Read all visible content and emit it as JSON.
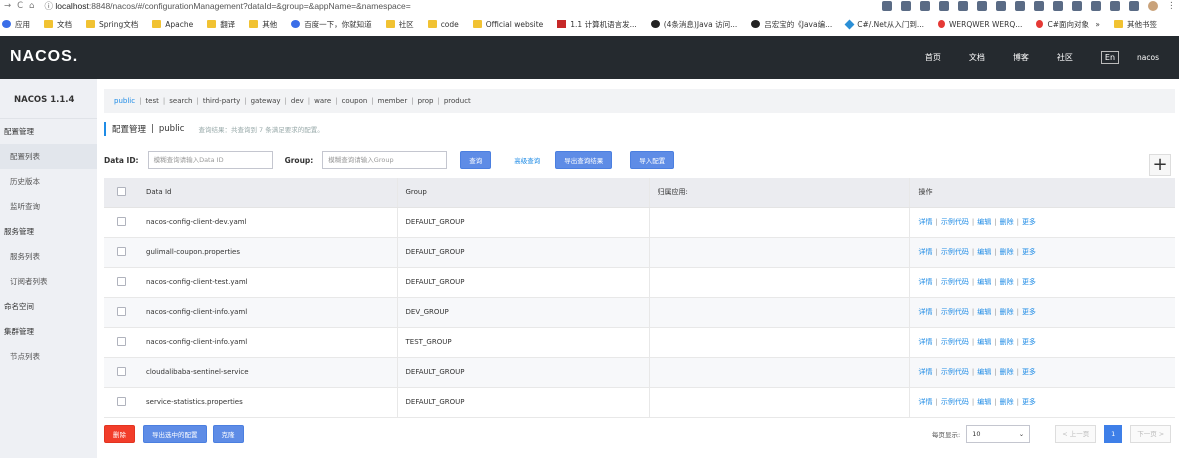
{
  "browser": {
    "url_prefix": "localhost",
    "url_rest": ":8848/nacos/#/configurationManagement?dataId=&group=&appName=&namespace=",
    "bookmarks": [
      {
        "label": "应用",
        "icon": "apps-icon"
      },
      {
        "label": "文档",
        "icon": "folder-icon"
      },
      {
        "label": "Spring文档",
        "icon": "folder-icon"
      },
      {
        "label": "Apache",
        "icon": "folder-icon"
      },
      {
        "label": "翻译",
        "icon": "folder-icon"
      },
      {
        "label": "其他",
        "icon": "folder-icon"
      },
      {
        "label": "百度一下，你就知道",
        "icon": "baidu-icon"
      },
      {
        "label": "社区",
        "icon": "folder-icon"
      },
      {
        "label": "code",
        "icon": "folder-icon"
      },
      {
        "label": "Official website",
        "icon": "folder-icon"
      },
      {
        "label": "1.1 计算机语言发...",
        "icon": "red-square-icon"
      },
      {
        "label": "(4条消息)Java 访问...",
        "icon": "github-icon"
      },
      {
        "label": "吕宏宝的《Java编...",
        "icon": "github-icon"
      },
      {
        "label": "C#/.Net从入门到...",
        "icon": "diamond-icon"
      },
      {
        "label": "WERQWER WERQ...",
        "icon": "red-dot-icon"
      },
      {
        "label": "C#面向对象编程-...",
        "icon": "flame-icon"
      }
    ],
    "bookmarks_more": "»",
    "bookmarks_other": "其他书签"
  },
  "nav": {
    "logo": "NACOS.",
    "links": [
      "首页",
      "文档",
      "博客",
      "社区"
    ],
    "lang": "En",
    "user": "nacos"
  },
  "sidebar": {
    "version": "NACOS 1.1.4",
    "items": [
      {
        "label": "配置管理",
        "sub": false,
        "active": false
      },
      {
        "label": "配置列表",
        "sub": true,
        "active": true
      },
      {
        "label": "历史版本",
        "sub": true,
        "active": false
      },
      {
        "label": "监听查询",
        "sub": true,
        "active": false
      },
      {
        "label": "服务管理",
        "sub": false,
        "active": false
      },
      {
        "label": "服务列表",
        "sub": true,
        "active": false
      },
      {
        "label": "订阅者列表",
        "sub": true,
        "active": false
      },
      {
        "label": "命名空间",
        "sub": false,
        "active": false
      },
      {
        "label": "集群管理",
        "sub": false,
        "active": false
      },
      {
        "label": "节点列表",
        "sub": true,
        "active": false
      }
    ]
  },
  "namespaces": [
    "public",
    "test",
    "search",
    "third-party",
    "gateway",
    "dev",
    "ware",
    "coupon",
    "member",
    "prop",
    "product"
  ],
  "title": {
    "main": "配置管理",
    "sep": "|",
    "ns": "public",
    "hint": "查询结果：共查询到 7 条满足要求的配置。"
  },
  "search": {
    "dataid_label": "Data ID:",
    "dataid_placeholder": "模糊查询请输入Data ID",
    "group_label": "Group:",
    "group_placeholder": "模糊查询请输入Group",
    "query_btn": "查询",
    "advanced": "高级查询",
    "export_btn": "导出查询结果",
    "import_btn": "导入配置",
    "add_btn": "+"
  },
  "table": {
    "headers": [
      "Data Id",
      "Group",
      "归属应用:",
      "操作"
    ],
    "ops": [
      "详情",
      "示例代码",
      "编辑",
      "删除",
      "更多"
    ],
    "rows": [
      {
        "id": "nacos-config-client-dev.yaml",
        "group": "DEFAULT_GROUP",
        "app": ""
      },
      {
        "id": "gulimall-coupon.properties",
        "group": "DEFAULT_GROUP",
        "app": ""
      },
      {
        "id": "nacos-config-client-test.yaml",
        "group": "DEFAULT_GROUP",
        "app": ""
      },
      {
        "id": "nacos-config-client-info.yaml",
        "group": "DEV_GROUP",
        "app": ""
      },
      {
        "id": "nacos-config-client-info.yaml",
        "group": "TEST_GROUP",
        "app": ""
      },
      {
        "id": "cloudalibaba-sentinel-service",
        "group": "DEFAULT_GROUP",
        "app": ""
      },
      {
        "id": "service-statistics.properties",
        "group": "DEFAULT_GROUP",
        "app": ""
      }
    ]
  },
  "bottom": {
    "delete_btn": "删除",
    "export_selected_btn": "导出选中的配置",
    "clone_btn": "克隆",
    "page_size_label": "每页显示:",
    "page_size": "10",
    "prev": "< 上一页",
    "page": "1",
    "next": "下一页 >"
  },
  "colors": {
    "accent": "#1f8ce6",
    "nav_bg": "#252a2f",
    "sidebar_bg": "#eef0f4",
    "danger": "#f23d2a",
    "primary": "#5e8ce6"
  }
}
